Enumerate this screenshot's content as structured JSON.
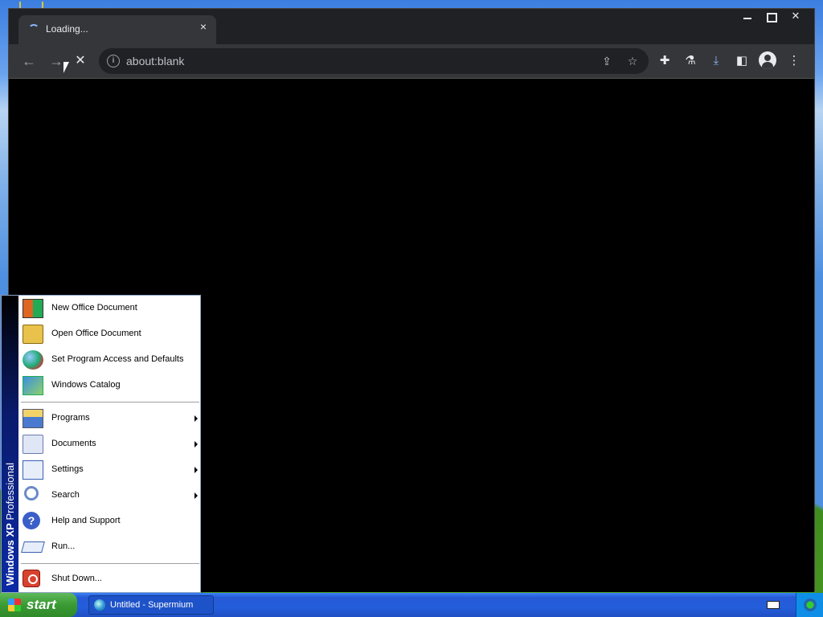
{
  "browser": {
    "tab_title": "Loading...",
    "tab_close": "×",
    "omnibox_text": "about:blank",
    "nav": {
      "back": "←",
      "forward": "→",
      "stop": "✕"
    }
  },
  "start_menu": {
    "sidebar_bold": "Windows XP",
    "sidebar_rest": " Professional",
    "top_items": [
      {
        "label": "New Office Document"
      },
      {
        "label": "Open Office Document"
      },
      {
        "label": "Set Program Access and Defaults"
      },
      {
        "label": "Windows Catalog"
      }
    ],
    "main_items": [
      {
        "label": "Programs"
      },
      {
        "label": "Documents"
      },
      {
        "label": "Settings"
      },
      {
        "label": "Search"
      },
      {
        "label": "Help and Support"
      },
      {
        "label": "Run..."
      }
    ],
    "shutdown": "Shut Down..."
  },
  "taskbar": {
    "start_label": "start",
    "task_label": "Untitled - Supermium"
  }
}
